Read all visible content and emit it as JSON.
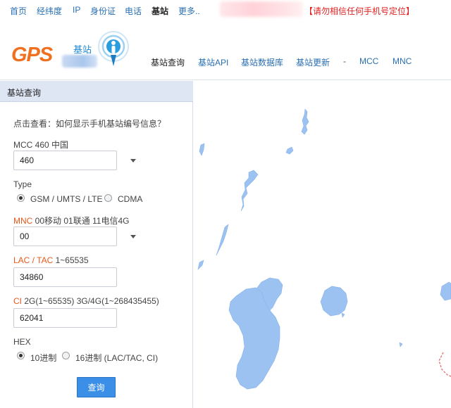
{
  "topnav": {
    "items": [
      "首页",
      "经纬度",
      "IP",
      "身份证",
      "电话",
      "基站",
      "更多.."
    ],
    "warning": "【请勿相信任何手机号定位】"
  },
  "header": {
    "logo_text": "GPS",
    "logo_sub": "基站"
  },
  "mainnav": {
    "items": [
      "基站查询",
      "基站API",
      "基站数据库",
      "基站更新",
      "-",
      "MCC",
      "MNC"
    ]
  },
  "panel": {
    "title": "基站查询",
    "help_link": "点击查看：如何显示手机基站编号信息？",
    "mcc": {
      "label": "MCC 460 中国",
      "value": "460"
    },
    "type": {
      "label": "Type",
      "options": [
        "GSM / UMTS / LTE",
        "CDMA"
      ],
      "selected": 0
    },
    "mnc": {
      "label_hl": "MNC",
      "label_rest": " 00移动 01联通 11电信4G",
      "value": "00"
    },
    "lac": {
      "label_hl": "LAC / TAC",
      "label_rest": " 1~65535",
      "value": "34860"
    },
    "ci": {
      "label_hl": "CI",
      "label_rest": " 2G(1~65535) 3G/4G(1~268435455)",
      "value": "62041"
    },
    "hex": {
      "label": "HEX",
      "options": [
        "10进制",
        "16进制 (LAC/TAC, CI)"
      ],
      "selected": 0
    },
    "submit_label": "查询"
  },
  "colors": {
    "link": "#2a6fb0",
    "accent_orange": "#e8581c",
    "warning_red": "#e02020",
    "button_blue": "#3b8fe6",
    "water": "#9cc2f2",
    "panel_header": "#dee5f3"
  }
}
